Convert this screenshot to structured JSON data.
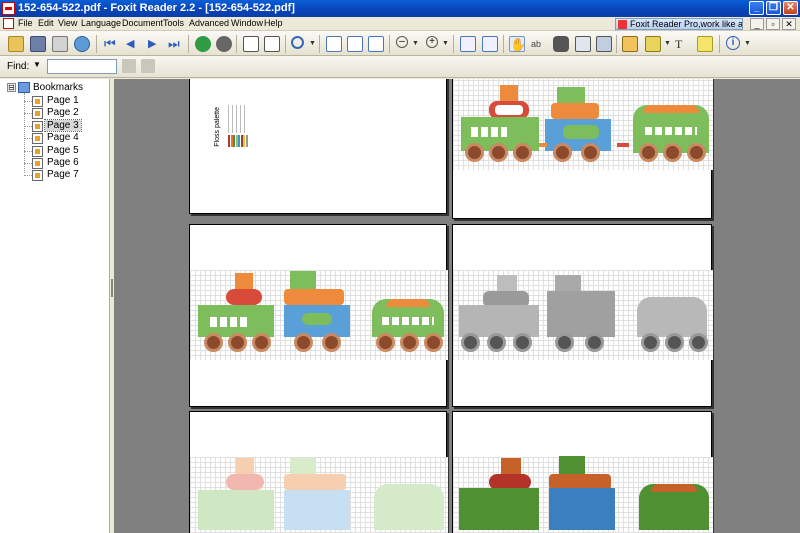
{
  "window": {
    "title": "152-654-522.pdf - Foxit Reader 2.2 - [152-654-522.pdf]",
    "controls": [
      "_",
      "❐",
      "✕"
    ]
  },
  "menu": {
    "items": [
      "File",
      "Edit",
      "View",
      "Language",
      "Document",
      "Tools",
      "Advanced",
      "Window",
      "Help"
    ],
    "ad_text": "Foxit Reader Pro,work like a pro!",
    "mdi_controls": [
      "_",
      "▫",
      "✕"
    ]
  },
  "toolbar": {
    "icons": [
      "open-icon",
      "save-icon",
      "print-icon",
      "email-icon",
      "first-page-icon",
      "prev-page-icon",
      "next-page-icon",
      "last-page-icon",
      "back-icon",
      "forward-icon",
      "rotate-left-icon",
      "rotate-right-icon",
      "zoom-icon",
      "actual-size-icon",
      "fit-page-icon",
      "fit-width-icon",
      "zoom-out-icon",
      "zoom-in-icon",
      "single-page-icon",
      "continuous-icon",
      "hand-tool-icon",
      "text-select-icon",
      "find-icon",
      "snapshot-icon",
      "image-icon",
      "edit-icon",
      "highlight-icon",
      "typewriter-icon",
      "note-icon",
      "info-icon"
    ]
  },
  "find": {
    "label": "Find:",
    "value": ""
  },
  "sidebar": {
    "root": "Bookmarks",
    "expander": "⊟",
    "items": [
      {
        "label": "Page 1",
        "selected": false
      },
      {
        "label": "Page 2",
        "selected": false
      },
      {
        "label": "Page 3",
        "selected": true
      },
      {
        "label": "Page 4",
        "selected": false
      },
      {
        "label": "Page 5",
        "selected": false
      },
      {
        "label": "Page 6",
        "selected": false
      },
      {
        "label": "Page 7",
        "selected": false
      }
    ]
  },
  "document": {
    "palette_title": "Floss palette",
    "palette_colors": [
      "#b2352d",
      "#e57a2f",
      "#4e8a3b",
      "#8bc476",
      "#4c8fd1",
      "#8b4a2b",
      "#f2c037",
      "#999999"
    ],
    "train_colors": {
      "green": "#7dbd5c",
      "blue": "#5aa0d8",
      "orange": "#ee8a3b",
      "red": "#d84a3a",
      "brown": "#8b4a2b"
    }
  }
}
